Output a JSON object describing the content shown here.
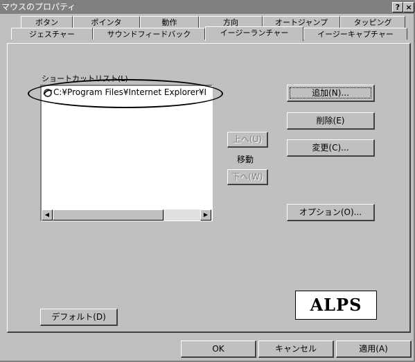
{
  "window": {
    "title": "マウスのプロパティ",
    "help_btn": "?",
    "close_btn": "×"
  },
  "tabs_row1": [
    "ボタン",
    "ポインタ",
    "動作",
    "方向",
    "オートジャンプ",
    "タッピング"
  ],
  "tabs_row2": [
    "ジェスチャー",
    "サウンドフィードバック",
    "イージーランチャー",
    "イージーキャプチャー"
  ],
  "active_tab": "イージーランチャー",
  "shortcut_list": {
    "label": "ショートカットリスト(L)",
    "items": [
      "C:¥Program Files¥Internet Explorer¥I"
    ]
  },
  "buttons": {
    "add": "追加(N)...",
    "delete": "削除(E)",
    "change": "変更(C)...",
    "options": "オプション(O)...",
    "up": "上へ(U)",
    "move_label": "移動",
    "down": "下へ(W)",
    "default": "デフォルト(D)",
    "ok": "OK",
    "cancel": "キャンセル",
    "apply": "適用(A)"
  },
  "logo_text": "ALPS"
}
